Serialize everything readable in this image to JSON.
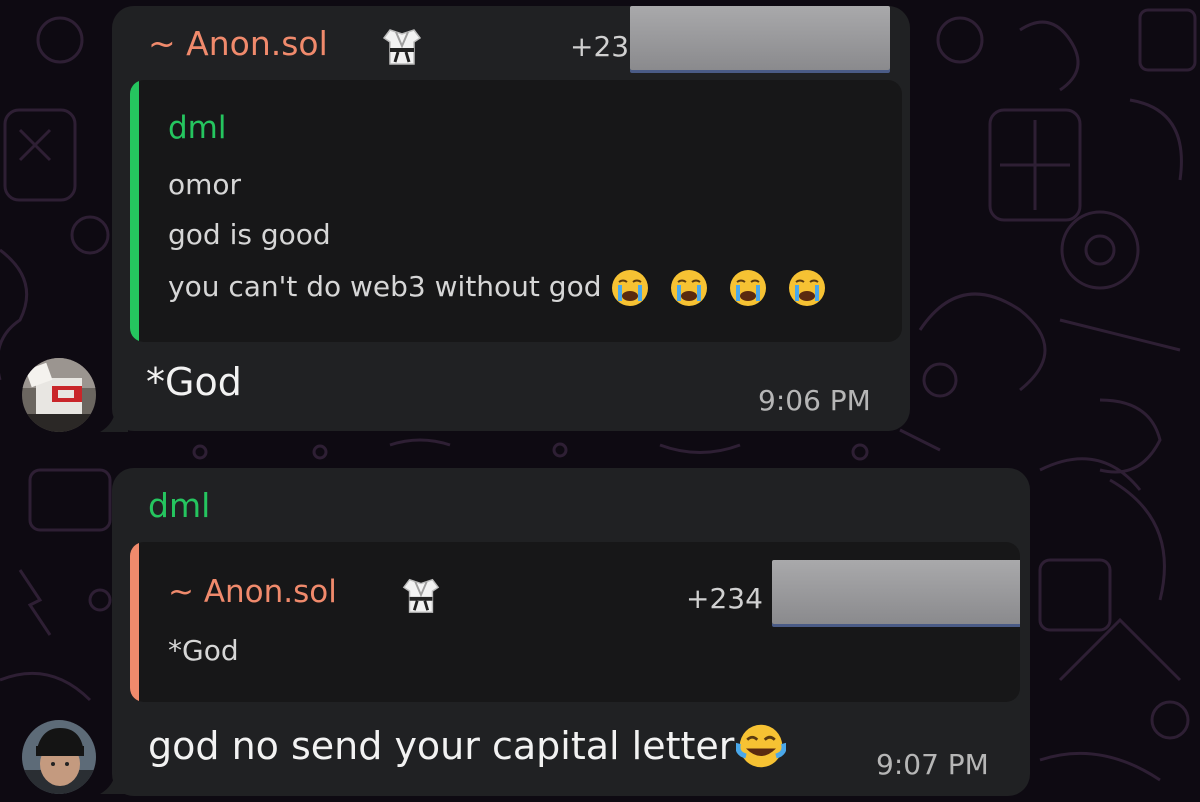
{
  "messages": [
    {
      "sender": "~ Anon.sol",
      "sender_icon": "karate-uniform-icon",
      "phone_prefix": "+23",
      "quoted": {
        "name": "dml",
        "lines": [
          "omor",
          "god is good",
          "you can't do web3 without god"
        ],
        "emoji": [
          "crying-face-icon",
          "crying-face-icon",
          "crying-face-icon",
          "crying-face-icon"
        ]
      },
      "text": "*God",
      "time": "9:06 PM"
    },
    {
      "sender": "dml",
      "quoted": {
        "name": "~ Anon.sol",
        "name_icon": "karate-uniform-icon",
        "phone_prefix": "+234",
        "lines": [
          "*God"
        ]
      },
      "text": "god no send your capital letter",
      "text_emoji": "tears-of-joy-icon",
      "time": "9:07 PM"
    }
  ],
  "colors": {
    "background": "#0e0a12",
    "bubble": "#202123",
    "quote_bg": "#171718",
    "green_name": "#25c55f",
    "salmon_name": "#f08a6c"
  }
}
